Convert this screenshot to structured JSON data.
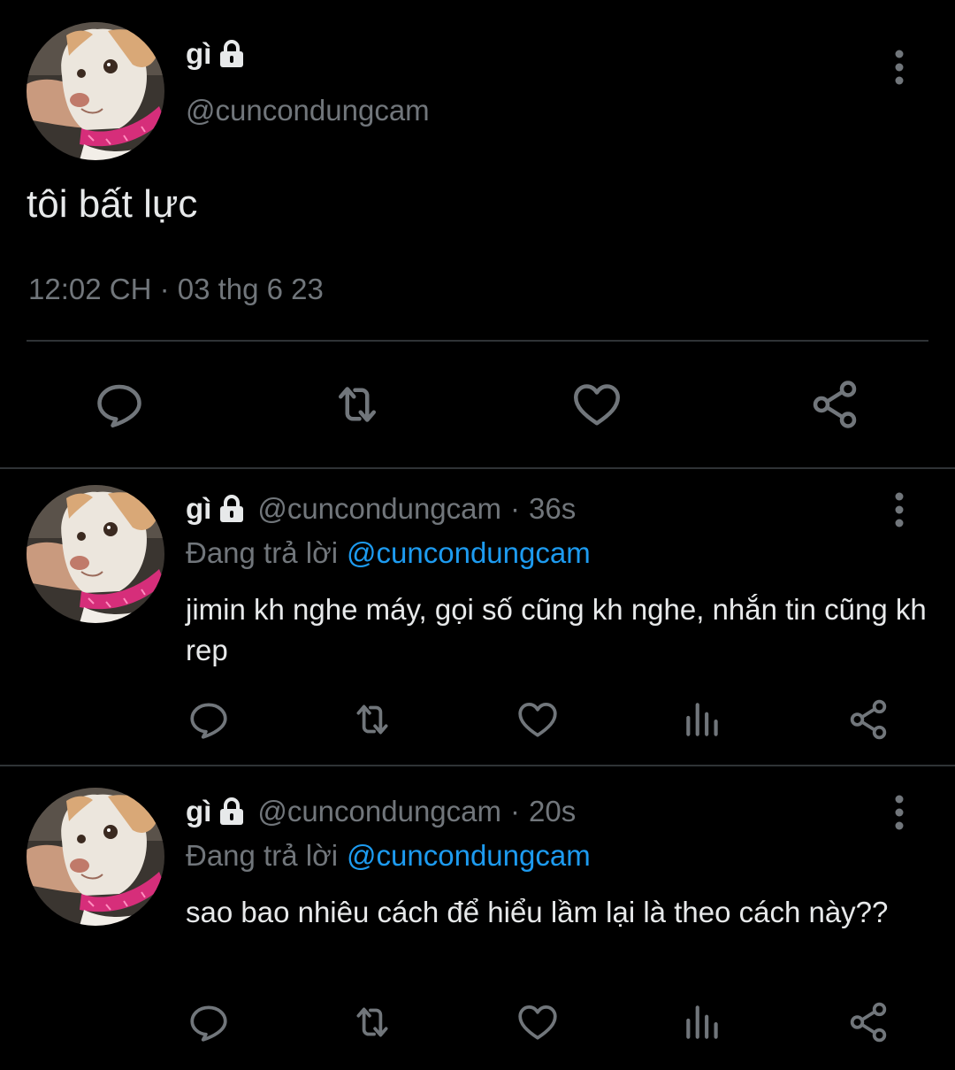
{
  "colors": {
    "background": "#000000",
    "primary_text": "#e7e9ea",
    "secondary_text": "#71767b",
    "link": "#1d9bf0",
    "divider": "#2f3336"
  },
  "main_tweet": {
    "display_name": "gì",
    "handle": "@cuncondungcam",
    "text": "tôi bất lực",
    "timestamp": "12:02 CH · 03 thg 6 23",
    "icons": [
      "lock-icon",
      "more-icon",
      "reply-icon",
      "retweet-icon",
      "like-icon",
      "share-icon"
    ]
  },
  "replies": [
    {
      "display_name": "gì",
      "handle": "@cuncondungcam",
      "separator": "·",
      "time": "36s",
      "replying_to_label": "Đang trả lời",
      "replying_to_handle": "@cuncondungcam",
      "text": "jimin kh nghe máy, gọi số cũng kh nghe, nhắn tin cũng kh rep"
    },
    {
      "display_name": "gì",
      "handle": "@cuncondungcam",
      "separator": "·",
      "time": "20s",
      "replying_to_label": "Đang trả lời",
      "replying_to_handle": "@cuncondungcam",
      "text": "sao bao nhiêu cách để hiểu lầm lại là theo cách này??"
    }
  ]
}
